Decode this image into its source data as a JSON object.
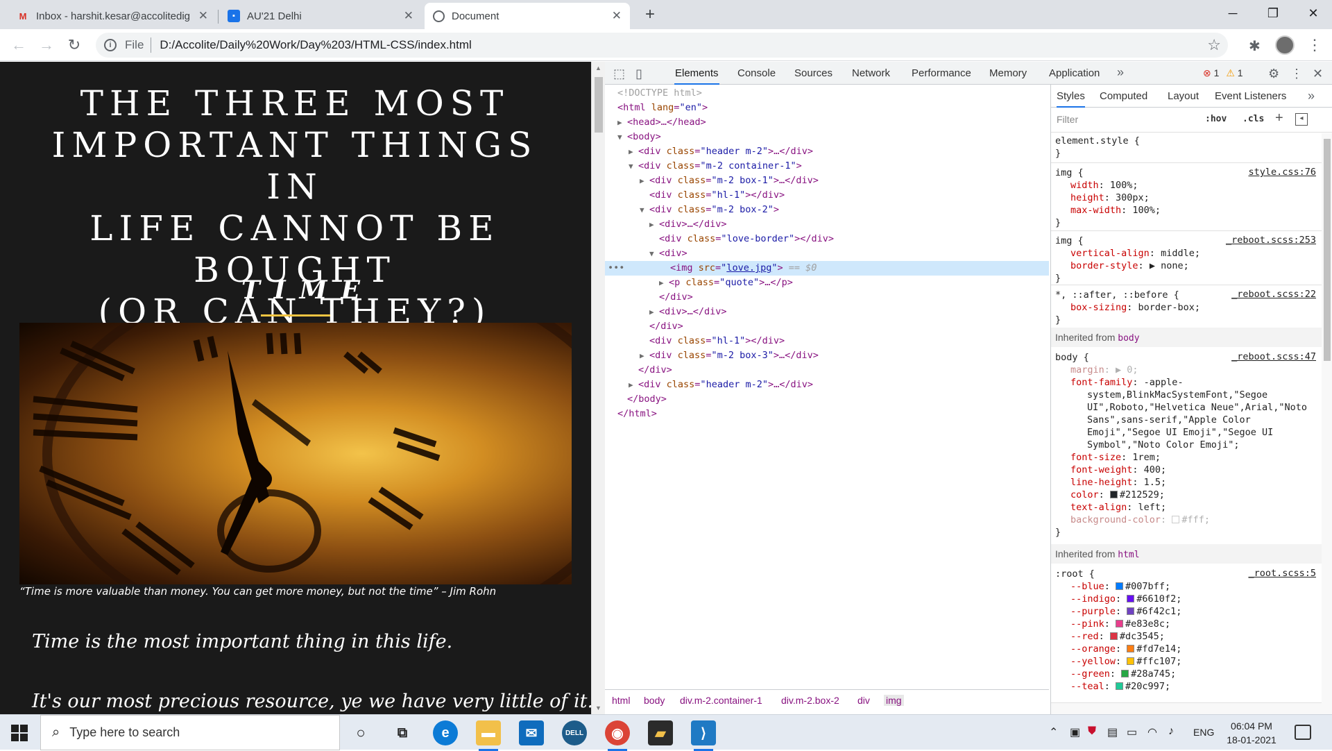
{
  "browser": {
    "tabs": [
      {
        "title": "Inbox - harshit.kesar@accolitedig",
        "icon": "gmail-icon"
      },
      {
        "title": "AU'21 Delhi",
        "icon": "contacts-icon"
      },
      {
        "title": "Document",
        "icon": "globe-icon"
      }
    ],
    "address": {
      "scheme": "File",
      "url": "D:/Accolite/Daily%20Work/Day%203/HTML-CSS/index.html"
    }
  },
  "page": {
    "title_lines": [
      "THE THREE MOST",
      "IMPORTANT THINGS IN",
      "LIFE CANNOT BE BOUGHT",
      "(OR CAN THEY?)"
    ],
    "section_heading": "TIME",
    "quote": "“Time is more valuable than money. You can get more money, but not the time” – Jim Rohn",
    "paragraph_1": "Time is the most important thing in this life.",
    "paragraph_2": "It's our most precious resource, ye we have very little of it. Not"
  },
  "devtools": {
    "tabs": [
      "Elements",
      "Console",
      "Sources",
      "Network",
      "Performance",
      "Memory",
      "Application"
    ],
    "errors": "1",
    "warnings": "1",
    "dom": {
      "doctype": "<!DOCTYPE html>",
      "html_open_tag": "<html ",
      "html_attr": "lang",
      "html_val": "\"en\"",
      "head": "<head>…</head>",
      "body_open": "<body>",
      "header_div": "header m-2",
      "container_div": "m-2 container-1",
      "box1_div": "m-2 box-1",
      "hl1_div": "hl-1",
      "box2_div": "m-2 box-2",
      "div_collapsed": "<div>…</div>",
      "love_border_div": "love-border",
      "div_open": "<div>",
      "img_src": "love.jpg",
      "selected_suffix": "== $0",
      "quote_p": "quote",
      "div_close": "</div>",
      "box3_div": "m-2 box-3",
      "body_close": "</body>",
      "html_close": "</html>"
    },
    "breadcrumb": [
      "html",
      "body",
      "div.m-2.container-1",
      "div.m-2.box-2",
      "div",
      "img"
    ],
    "styles_tabs": [
      "Styles",
      "Computed",
      "Layout",
      "Event Listeners"
    ],
    "filter_placeholder": "Filter",
    "hov": ":hov",
    "cls": ".cls",
    "rules": {
      "element_style": "element.style {",
      "img1_selector": "img {",
      "img1_source": "style.css:76",
      "img1_props": [
        {
          "name": "width",
          "value": "100%;"
        },
        {
          "name": "height",
          "value": "300px;"
        },
        {
          "name": "max-width",
          "value": "100%;"
        }
      ],
      "img2_source": "_reboot.scss:253",
      "img2_props": [
        {
          "name": "vertical-align",
          "value": "middle;"
        },
        {
          "name": "border-style",
          "value": "▶ none;"
        }
      ],
      "universal_selector": "*, ::after, ::before {",
      "universal_source": "_reboot.scss:22",
      "universal_props": [
        {
          "name": "box-sizing",
          "value": "border-box;"
        }
      ],
      "inherited_body_label": "Inherited from",
      "inherited_body_el": "body",
      "body_selector": "body {",
      "body_source": "_reboot.scss:47",
      "body_margin": {
        "name": "margin",
        "value": "▶ 0;"
      },
      "body_font_family_name": "font-family",
      "body_font_family_lines": [
        "-apple-",
        "system,BlinkMacSystemFont,\"Segoe",
        "UI\",Roboto,\"Helvetica Neue\",Arial,\"Noto",
        "Sans\",sans-serif,\"Apple Color",
        "Emoji\",\"Segoe UI Emoji\",\"Segoe UI",
        "Symbol\",\"Noto Color Emoji\";"
      ],
      "body_props": [
        {
          "name": "font-size",
          "value": "1rem;"
        },
        {
          "name": "font-weight",
          "value": "400;"
        },
        {
          "name": "line-height",
          "value": "1.5;"
        },
        {
          "name": "color",
          "value": "#212529;",
          "swatch": "#212529"
        },
        {
          "name": "text-align",
          "value": "left;"
        },
        {
          "name": "background-color",
          "value": "#fff;",
          "swatch": "#ffffff"
        }
      ],
      "inherited_html_label": "Inherited from",
      "inherited_html_el": "html",
      "root_selector": ":root {",
      "root_source": "_root.scss:5",
      "root_vars": [
        {
          "name": "--blue",
          "value": "#007bff;",
          "swatch": "#007bff"
        },
        {
          "name": "--indigo",
          "value": "#6610f2;",
          "swatch": "#6610f2"
        },
        {
          "name": "--purple",
          "value": "#6f42c1;",
          "swatch": "#6f42c1"
        },
        {
          "name": "--pink",
          "value": "#e83e8c;",
          "swatch": "#e83e8c"
        },
        {
          "name": "--red",
          "value": "#dc3545;",
          "swatch": "#dc3545"
        },
        {
          "name": "--orange",
          "value": "#fd7e14;",
          "swatch": "#fd7e14"
        },
        {
          "name": "--yellow",
          "value": "#ffc107;",
          "swatch": "#ffc107"
        },
        {
          "name": "--green",
          "value": "#28a745;",
          "swatch": "#28a745"
        },
        {
          "name": "--teal",
          "value": "#20c997;",
          "swatch": "#20c997"
        }
      ]
    }
  },
  "taskbar": {
    "search_placeholder": "Type here to search",
    "language": "ENG",
    "time": "06:04 PM",
    "date": "18-01-2021"
  }
}
